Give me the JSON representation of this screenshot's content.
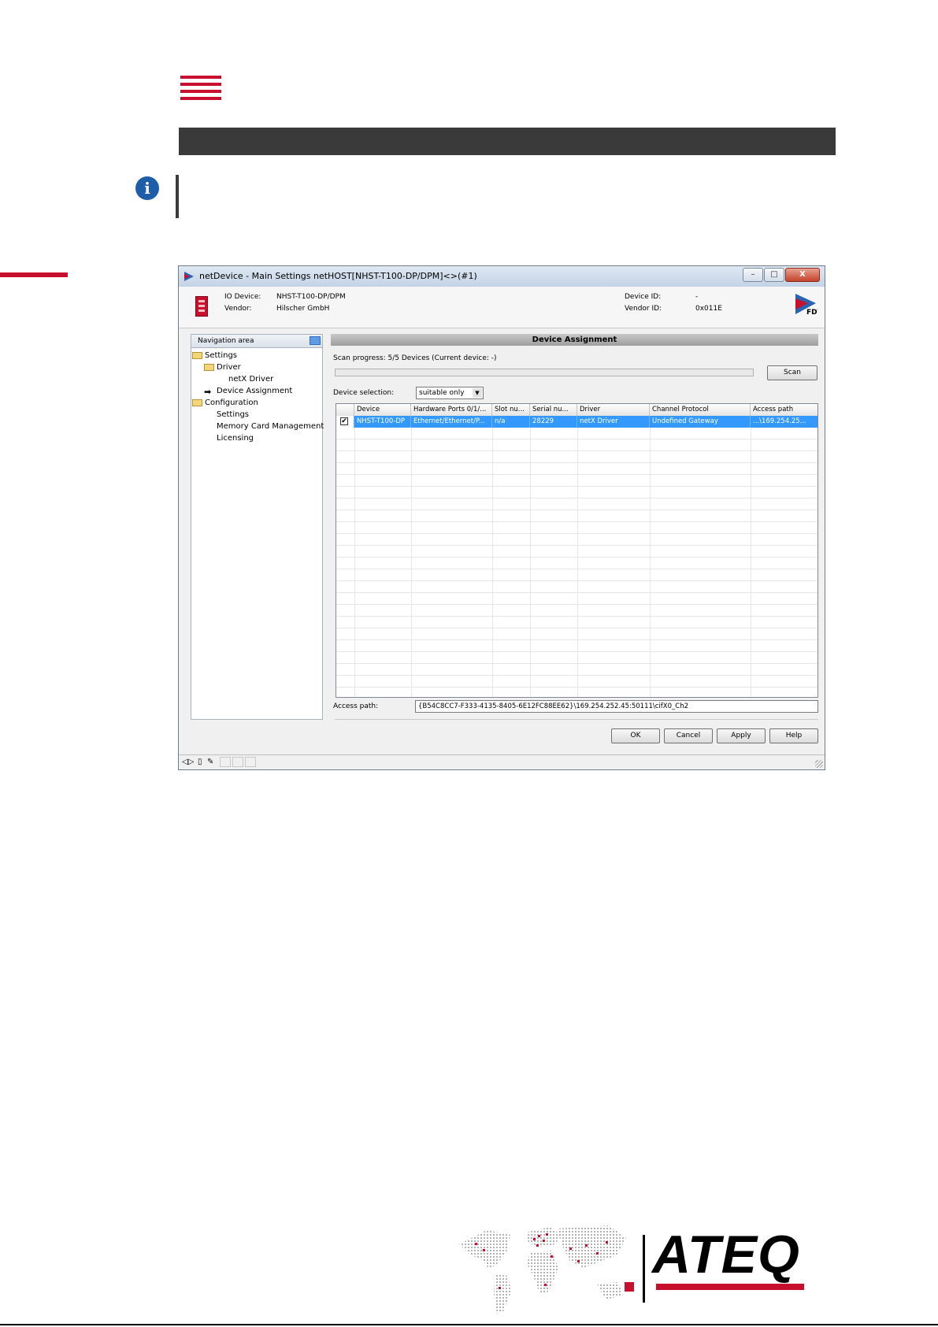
{
  "window": {
    "title": "netDevice - Main Settings netHOST[NHST-T100-DP/DPM]<>(#1)",
    "buttons": {
      "minimize": "–",
      "maximize": "□",
      "close": "X"
    }
  },
  "device_info": {
    "io_device_label": "IO Device:",
    "io_device_value": "NHST-T100-DP/DPM",
    "vendor_label": "Vendor:",
    "vendor_value": "Hilscher GmbH",
    "device_id_label": "Device ID:",
    "device_id_value": "-",
    "vendor_id_label": "Vendor ID:",
    "vendor_id_value": "0x011E",
    "logo_text": "FDT"
  },
  "navigation": {
    "header": "Navigation area",
    "items": [
      {
        "label": "Settings",
        "level": 0,
        "icon": "folder-icon"
      },
      {
        "label": "Driver",
        "level": 1,
        "icon": "folder-icon"
      },
      {
        "label": "netX Driver",
        "level": 2,
        "icon": ""
      },
      {
        "label": "Device Assignment",
        "level": 1,
        "icon": "arrow-right-icon"
      },
      {
        "label": "Configuration",
        "level": 0,
        "icon": "folder-icon"
      },
      {
        "label": "Settings",
        "level": 1,
        "icon": ""
      },
      {
        "label": "Memory Card Management",
        "level": 1,
        "icon": ""
      },
      {
        "label": "Licensing",
        "level": 1,
        "icon": ""
      }
    ]
  },
  "main": {
    "header": "Device Assignment",
    "scan_progress": "Scan progress: 5/5 Devices (Current device: -)",
    "scan_button": "Scan",
    "device_selection_label": "Device selection:",
    "device_selection_value": "suitable only",
    "table": {
      "columns": [
        "Device",
        "Hardware Ports 0/1/...",
        "Slot nu...",
        "Serial nu...",
        "Driver",
        "Channel Protocol",
        "Access path"
      ],
      "rows": [
        {
          "checked": true,
          "cells": [
            "NHST-T100-DP",
            "Ethernet/Ethernet/P...",
            "n/a",
            "28229",
            "netX Driver",
            "Undefined Gateway",
            "...\\169.254.25..."
          ]
        }
      ]
    },
    "access_path_label": "Access path:",
    "access_path_value": "{B54C8CC7-F333-4135-8405-6E12FC88EE62}\\169.254.252.45:50111\\cifX0_Ch2",
    "buttons": {
      "ok": "OK",
      "cancel": "Cancel",
      "apply": "Apply",
      "help": "Help"
    }
  },
  "footer_logo": {
    "brand": "ATEQ"
  },
  "colors": {
    "accent_red": "#c8102e",
    "selection_blue": "#3399ff",
    "dark_bar": "#3a3a3a",
    "info_blue": "#1e5ea8"
  }
}
